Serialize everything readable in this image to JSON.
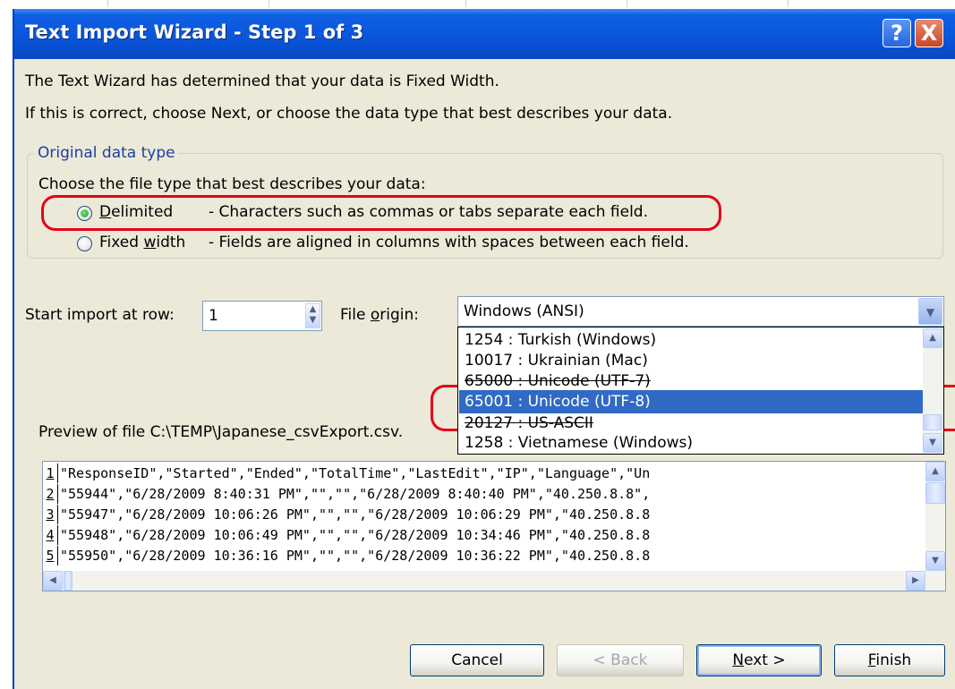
{
  "window": {
    "title": "Text Import Wizard - Step 1 of 3",
    "help_glyph": "?",
    "close_glyph": "X"
  },
  "intro": {
    "line1": "The Text Wizard has determined that your data is Fixed Width.",
    "line2": "If this is correct, choose Next, or choose the data type that best describes your data."
  },
  "original_data_type": {
    "legend": "Original data type",
    "prompt": "Choose the file type that best describes your data:",
    "options": [
      {
        "label": "Delimited",
        "mnemonic": "D",
        "rest": "elimited",
        "description": "- Characters such as commas or tabs separate each field.",
        "selected": true
      },
      {
        "label": "Fixed width",
        "pre": "Fixed ",
        "mnemonic": "w",
        "rest": "idth",
        "description": "- Fields are aligned in columns with spaces between each field.",
        "selected": false
      }
    ]
  },
  "start_row": {
    "label": "Start import at row:",
    "value": "1"
  },
  "file_origin": {
    "label_pre": "File ",
    "label_mnemonic": "o",
    "label_rest": "rigin:",
    "selected": "Windows (ANSI)",
    "options": [
      {
        "text": " 1254 : Turkish (Windows)",
        "selected": false
      },
      {
        "text": "10017 : Ukrainian (Mac)",
        "selected": false
      },
      {
        "text": "65000 : Unicode (UTF-7)",
        "selected": false
      },
      {
        "text": "65001 : Unicode (UTF-8)",
        "selected": true
      },
      {
        "text": "20127 : US-ASCII",
        "selected": false
      },
      {
        "text": " 1258 : Vietnamese (Windows)",
        "selected": false
      }
    ]
  },
  "preview": {
    "label": "Preview of file C:\\TEMP\\Japanese_csvExport.csv.",
    "rows": [
      {
        "num": "1",
        "text": "\"ResponseID\",\"Started\",\"Ended\",\"TotalTime\",\"LastEdit\",\"IP\",\"Language\",\"Un"
      },
      {
        "num": "2",
        "text": "\"55944\",\"6/28/2009 8:40:31 PM\",\"\",\"\",\"6/28/2009 8:40:40 PM\",\"40.250.8.8\","
      },
      {
        "num": "3",
        "text": "\"55947\",\"6/28/2009 10:06:26 PM\",\"\",\"\",\"6/28/2009 10:06:29 PM\",\"40.250.8.8"
      },
      {
        "num": "4",
        "text": "\"55948\",\"6/28/2009 10:06:49 PM\",\"\",\"\",\"6/28/2009 10:34:46 PM\",\"40.250.8.8"
      },
      {
        "num": "5",
        "text": "\"55950\",\"6/28/2009 10:36:16 PM\",\"\",\"\",\"6/28/2009 10:36:22 PM\",\"40.250.8.8"
      }
    ]
  },
  "buttons": {
    "cancel": "Cancel",
    "back": "< Back",
    "next_mnemonic": "N",
    "next_rest": "ext >",
    "finish_mnemonic": "F",
    "finish_rest": "inish"
  },
  "colors": {
    "title_bar": "#0a55d9",
    "highlight": "#316ac5",
    "annotation": "#e2001a",
    "dialog_bg": "#ece9d8"
  },
  "icons": {
    "spin_up": "up-arrow-icon",
    "spin_down": "down-arrow-icon",
    "combo": "chevron-down-icon",
    "scroll_left": "left-arrow-icon",
    "scroll_right": "right-arrow-icon"
  }
}
